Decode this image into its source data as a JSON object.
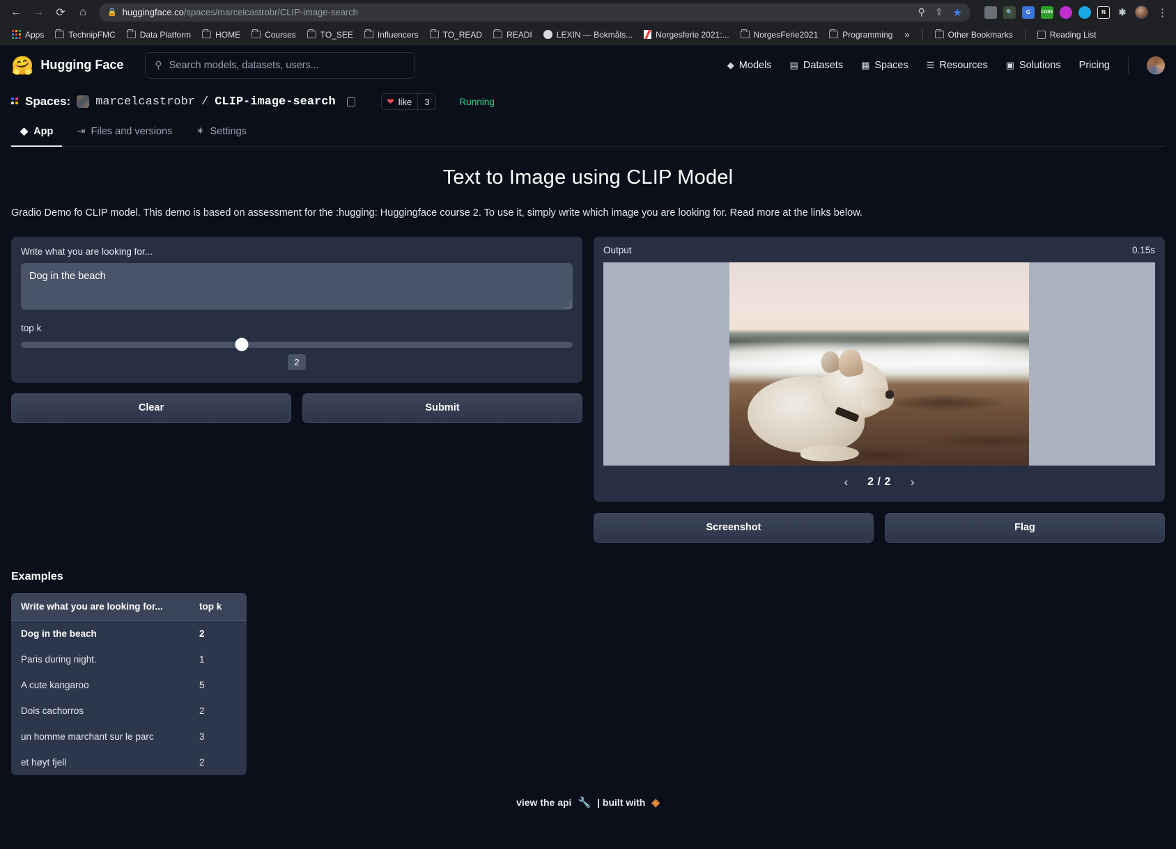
{
  "browser": {
    "url_domain": "huggingface.co",
    "url_path": "/spaces/marcelcastrobr/CLIP-image-search",
    "nav": {
      "back": "←",
      "forward": "→",
      "reload": "⟳",
      "home": "⌂"
    },
    "lock_icon": "🔒",
    "omni_actions": [
      {
        "name": "zoom-icon",
        "glyph": "⌖"
      },
      {
        "name": "share-icon",
        "glyph": "⇪"
      },
      {
        "name": "bookmark-star-icon",
        "glyph": "★"
      }
    ],
    "extensions": [
      {
        "name": "extension-tabs",
        "label": "",
        "color": "#6b7078",
        "round": false
      },
      {
        "name": "extension-magnifier",
        "label": "",
        "color": "#3d4a3a",
        "round": false
      },
      {
        "name": "extension-google-translate",
        "label": "G",
        "color": "#3b74d6",
        "round": false
      },
      {
        "name": "extension-cors",
        "label": "CORS",
        "color": "#2f9e28",
        "round": false
      },
      {
        "name": "extension-purple",
        "label": "",
        "color": "#c22fd1",
        "round": true
      },
      {
        "name": "extension-cyan",
        "label": "",
        "color": "#1aa8e0",
        "round": true
      },
      {
        "name": "extension-notes",
        "label": "N",
        "color": "#1b1b1b",
        "round": false
      },
      {
        "name": "extension-puzzle",
        "label": "🧩",
        "color": "#9aa0a6",
        "round": false
      }
    ],
    "kebab": "⋮",
    "bookmarks": [
      {
        "label": "Apps",
        "icon": "apps-grid"
      },
      {
        "label": "TechnipFMC",
        "icon": "folder"
      },
      {
        "label": "Data Platform",
        "icon": "folder"
      },
      {
        "label": "HOME",
        "icon": "folder"
      },
      {
        "label": "Courses",
        "icon": "folder"
      },
      {
        "label": "TO_SEE",
        "icon": "folder"
      },
      {
        "label": "Influencers",
        "icon": "folder"
      },
      {
        "label": "TO_READ",
        "icon": "folder"
      },
      {
        "label": "READI",
        "icon": "folder"
      },
      {
        "label": "LEXIN — Bokmåls...",
        "icon": "globe"
      },
      {
        "label": "Norgesferie 2021:...",
        "icon": "norge"
      },
      {
        "label": "NorgesFerie2021",
        "icon": "folder"
      },
      {
        "label": "Programming",
        "icon": "folder"
      }
    ],
    "more_chevron": "»",
    "other_bookmarks": "Other Bookmarks",
    "reading_list": "Reading List"
  },
  "hf_header": {
    "brand": "Hugging Face",
    "logo_glyph": "🤗",
    "search_placeholder": "Search models, datasets, users...",
    "search_value": "",
    "nav": [
      {
        "label": "Models",
        "icon": "cube-icon",
        "glyph": "◆"
      },
      {
        "label": "Datasets",
        "icon": "database-icon",
        "glyph": "▤"
      },
      {
        "label": "Spaces",
        "icon": "grid-icon",
        "glyph": "▦"
      },
      {
        "label": "Resources",
        "icon": "menu-icon",
        "glyph": "☰"
      },
      {
        "label": "Solutions",
        "icon": "briefcase-icon",
        "glyph": "▣"
      },
      {
        "label": "Pricing",
        "icon": "",
        "glyph": ""
      }
    ]
  },
  "space": {
    "spaces_label": "Spaces:",
    "owner": "marcelcastrobr",
    "separator": "/",
    "name": "CLIP-image-search",
    "like_label": "like",
    "like_count": "3",
    "status": "Running",
    "status_color": "#3ecf8e",
    "tabs": [
      {
        "label": "App",
        "glyph": "◆",
        "active": true
      },
      {
        "label": "Files and versions",
        "glyph": "⇥",
        "active": false
      },
      {
        "label": "Settings",
        "glyph": "✾",
        "active": false
      }
    ]
  },
  "app": {
    "title": "Text to Image using CLIP Model",
    "description": "Gradio Demo fo CLIP model. This demo is based on assessment for the :hugging: Huggingface course 2. To use it, simply write which image you are looking for. Read more at the links below.",
    "input": {
      "textarea_label": "Write what you are looking for...",
      "textarea_value": "Dog in the beach",
      "slider_label": "top k",
      "slider_value": "2",
      "slider_percent": 40
    },
    "buttons": {
      "clear": "Clear",
      "submit": "Submit"
    },
    "output": {
      "label": "Output",
      "duration": "0.15s",
      "gallery_counter": "2 / 2",
      "prev_arrow": "‹",
      "next_arrow": "›",
      "image_alt": "white dog lying on a beach at sunset"
    },
    "output_buttons": {
      "screenshot": "Screenshot",
      "flag": "Flag"
    }
  },
  "examples": {
    "title": "Examples",
    "columns": [
      "Write what you are looking for...",
      "top k"
    ],
    "rows": [
      {
        "text": "Dog in the beach",
        "topk": "2"
      },
      {
        "text": "Paris during night.",
        "topk": "1"
      },
      {
        "text": "A cute kangaroo",
        "topk": "5"
      },
      {
        "text": "Dois cachorros",
        "topk": "2"
      },
      {
        "text": "un homme marchant sur le parc",
        "topk": "3"
      },
      {
        "text": "et høyt fjell",
        "topk": "2"
      }
    ]
  },
  "footer": {
    "api_text": "view the api",
    "wrench": "🔧",
    "pipe": "| built with",
    "gradio_glyph": "◈"
  }
}
